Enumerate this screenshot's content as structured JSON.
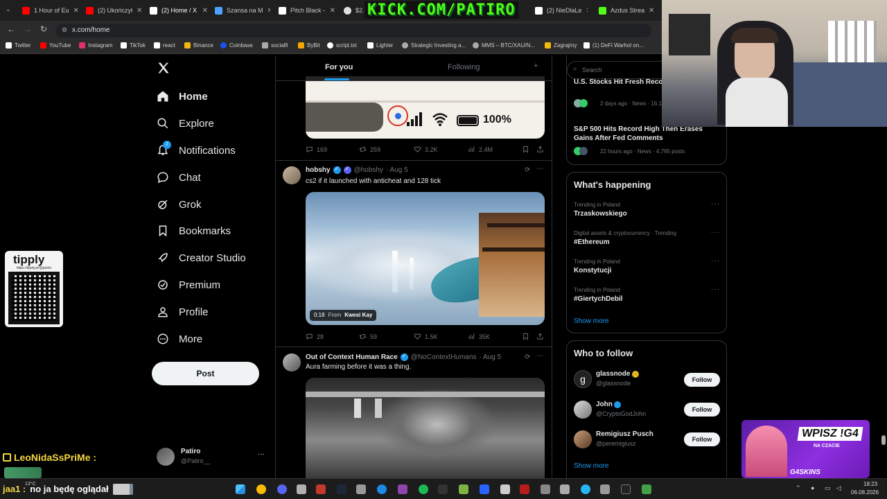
{
  "browser": {
    "tabs": [
      {
        "label": "1 Hour of Eu",
        "color": "#ff0000"
      },
      {
        "label": "(2) Ukończył",
        "color": "#ff0000"
      },
      {
        "label": "(2) Home / X",
        "color": "#ffffff"
      },
      {
        "label": "Szansa na M",
        "color": "#4aa3ff"
      },
      {
        "label": "Pitch Black -",
        "color": "#ffffff"
      },
      {
        "label": "$2.67",
        "color": "#e0e0e0"
      },
      {
        "label": "(2) NieDlaLe",
        "color": "#ffffff"
      },
      {
        "label": "Azdus Strea",
        "color": "#53fc18"
      }
    ],
    "url": "x.com/home",
    "bookmarks": [
      {
        "label": "Twitter",
        "color": "#ffffff"
      },
      {
        "label": "YouTube",
        "color": "#ff0000"
      },
      {
        "label": "Instagram",
        "color": "#e1306c"
      },
      {
        "label": "TikTok",
        "color": "#ffffff"
      },
      {
        "label": "react",
        "color": "#ffffff"
      },
      {
        "label": "Binance",
        "color": "#f0b90b"
      },
      {
        "label": "Coinbase",
        "color": "#1652f0"
      },
      {
        "label": "socialfi",
        "color": "#aaaaaa"
      },
      {
        "label": "ByBit",
        "color": "#f7a600"
      },
      {
        "label": "script.txt",
        "color": "#ffffff"
      },
      {
        "label": "Lighter",
        "color": "#ffffff"
      },
      {
        "label": "Strategic Investing a...",
        "color": "#aaaaaa"
      },
      {
        "label": "MMS – BTC/XAU/N...",
        "color": "#aaaaaa"
      },
      {
        "label": "Zagrajmy",
        "color": "#f0b90b"
      },
      {
        "label": "(1) DeFi Warhol on...",
        "color": "#ffffff"
      }
    ]
  },
  "overlay": {
    "kick_text": "KICK.COM/PATIRO",
    "tipply": "tipply",
    "tipply_url": "https://tipply.pl/@patiro",
    "chat_user": "LeoNidaSsPriMe :",
    "chat_msg_user": "jaa1 :",
    "chat_msg_text": "no ja będę oglądał",
    "promo_title": "WPISZ !G4",
    "promo_sub": "NA CZACIE",
    "promo_brand": "G4SKINS"
  },
  "sidebar": {
    "items": [
      {
        "label": "Home",
        "icon": "home-icon"
      },
      {
        "label": "Explore",
        "icon": "search-icon"
      },
      {
        "label": "Notifications",
        "icon": "bell-icon",
        "badge": "2"
      },
      {
        "label": "Chat",
        "icon": "chat-icon"
      },
      {
        "label": "Grok",
        "icon": "grok-icon"
      },
      {
        "label": "Bookmarks",
        "icon": "bookmark-icon"
      },
      {
        "label": "Creator Studio",
        "icon": "rocket-icon"
      },
      {
        "label": "Premium",
        "icon": "premium-icon"
      },
      {
        "label": "Profile",
        "icon": "person-icon"
      },
      {
        "label": "More",
        "icon": "more-icon"
      }
    ],
    "post_label": "Post",
    "account_name": "Patiro",
    "account_handle": "@Patiro__"
  },
  "feed": {
    "tab_for_you": "For you",
    "tab_following": "Following",
    "tweet0": {
      "battery": "100%",
      "replies": "169",
      "reposts": "259",
      "likes": "3.2K",
      "views": "2.4M"
    },
    "tweet1": {
      "name": "hobshy",
      "handle": "@hobshy",
      "date": "· Aug 5",
      "text": "cs2 if it launched with anticheat and 128 tick",
      "video_time": "0:18",
      "video_from": "From",
      "video_source": "Kwesi Kay",
      "replies": "28",
      "reposts": "59",
      "likes": "1.5K",
      "views": "35K"
    },
    "tweet2": {
      "name": "Out of Context Human Race",
      "handle": "@NoContextHumans",
      "date": "· Aug 5",
      "text": "Aura farming before it was a thing."
    }
  },
  "right": {
    "search_placeholder": "Search",
    "news": [
      {
        "title": "U.S. Stocks Hit Fresh Record at 7,736 High",
        "meta": "2 days ago · News · 16.1"
      },
      {
        "title": "S&P 500 Hits Record High Then Erases Gains After Fed Comments",
        "meta": "22 hours ago · News · 4,795 posts"
      }
    ],
    "happening_title": "What's happening",
    "trends": [
      {
        "sub": "Trending in Poland",
        "title": "Trzaskowskiego"
      },
      {
        "sub": "Digital assets & cryptocurrency · Trending",
        "title": "#Ethereum"
      },
      {
        "sub": "Trending in Poland",
        "title": "Konstytucji"
      },
      {
        "sub": "Trending in Poland",
        "title": "#GiertychDebil"
      }
    ],
    "show_more": "Show more",
    "who_title": "Who to follow",
    "follow": [
      {
        "name": "glassnode",
        "handle": "@glassnode",
        "btn": "Follow"
      },
      {
        "name": "John",
        "handle": "@CryptoGodJohn",
        "btn": "Follow"
      },
      {
        "name": "Remigiusz Pusch",
        "handle": "@peremigiusz",
        "btn": "Follow"
      }
    ],
    "show_more2": "Show more"
  },
  "taskbar": {
    "temp": "13°C",
    "time": "18:23",
    "date": "06.08.2026"
  }
}
